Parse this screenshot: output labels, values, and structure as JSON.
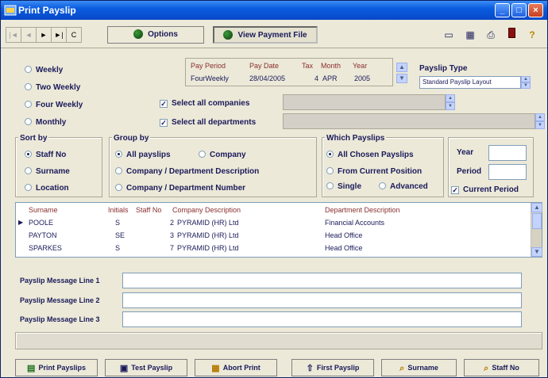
{
  "window": {
    "title": "Print Payslip"
  },
  "toolbar": {
    "nav": [
      "|◄",
      "◄",
      "►",
      "►|",
      "C"
    ],
    "options_label": "Options",
    "view_payment_label": "View Payment File"
  },
  "frequency": {
    "options": [
      "Weekly",
      "Two Weekly",
      "Four Weekly",
      "Monthly"
    ],
    "selected": "Four Weekly"
  },
  "pay_period": {
    "headers": [
      "Pay Period",
      "Pay Date",
      "Tax",
      "Month",
      "Year"
    ],
    "values": [
      "FourWeekly",
      "28/04/2005",
      "4",
      "APR",
      "2005"
    ]
  },
  "payslip_type": {
    "label": "Payslip Type",
    "value": "Standard Payslip Layout"
  },
  "select_all": {
    "companies_label": "Select all companies",
    "departments_label": "Select all departments"
  },
  "sort_by": {
    "title": "Sort by",
    "options": [
      "Staff No",
      "Surname",
      "Location"
    ],
    "selected": "Staff No"
  },
  "group_by": {
    "title": "Group by",
    "options": [
      "All payslips",
      "Company",
      "Company / Department Description",
      "Company / Department Number"
    ],
    "selected": "All payslips"
  },
  "which_payslips": {
    "title": "Which Payslips",
    "options": [
      "All Chosen Payslips",
      "From Current Position",
      "Single",
      "Advanced"
    ],
    "selected": "All Chosen Payslips"
  },
  "year_period": {
    "year_label": "Year",
    "period_label": "Period",
    "current_period_label": "Current Period"
  },
  "list": {
    "headers": [
      "Surname",
      "Initials",
      "Staff No",
      "Company Description",
      "Department Description"
    ],
    "rows": [
      {
        "surname": "POOLE",
        "initials": "S",
        "staff_no": "2",
        "company": "PYRAMID (HR) Ltd",
        "department": "Financial Accounts"
      },
      {
        "surname": "PAYTON",
        "initials": "SE",
        "staff_no": "3",
        "company": "PYRAMID (HR) Ltd",
        "department": "Head Office"
      },
      {
        "surname": "SPARKES",
        "initials": "S",
        "staff_no": "7",
        "company": "PYRAMID (HR) Ltd",
        "department": "Head Office"
      }
    ]
  },
  "messages": {
    "line1_label": "Payslip Message Line 1",
    "line2_label": "Payslip Message Line 2",
    "line3_label": "Payslip Message Line 3"
  },
  "bottom_buttons": {
    "print_payslips": "Print Payslips",
    "test_payslip": "Test Payslip",
    "abort_print": "Abort Print",
    "first_payslip": "First Payslip",
    "surname": "Surname",
    "staff_no": "Staff No"
  },
  "colors": {
    "title_bar": "#0a5ce0",
    "face": "#ece9d8",
    "label_text": "#1a1a5a",
    "header_text": "#8a2e2e"
  }
}
